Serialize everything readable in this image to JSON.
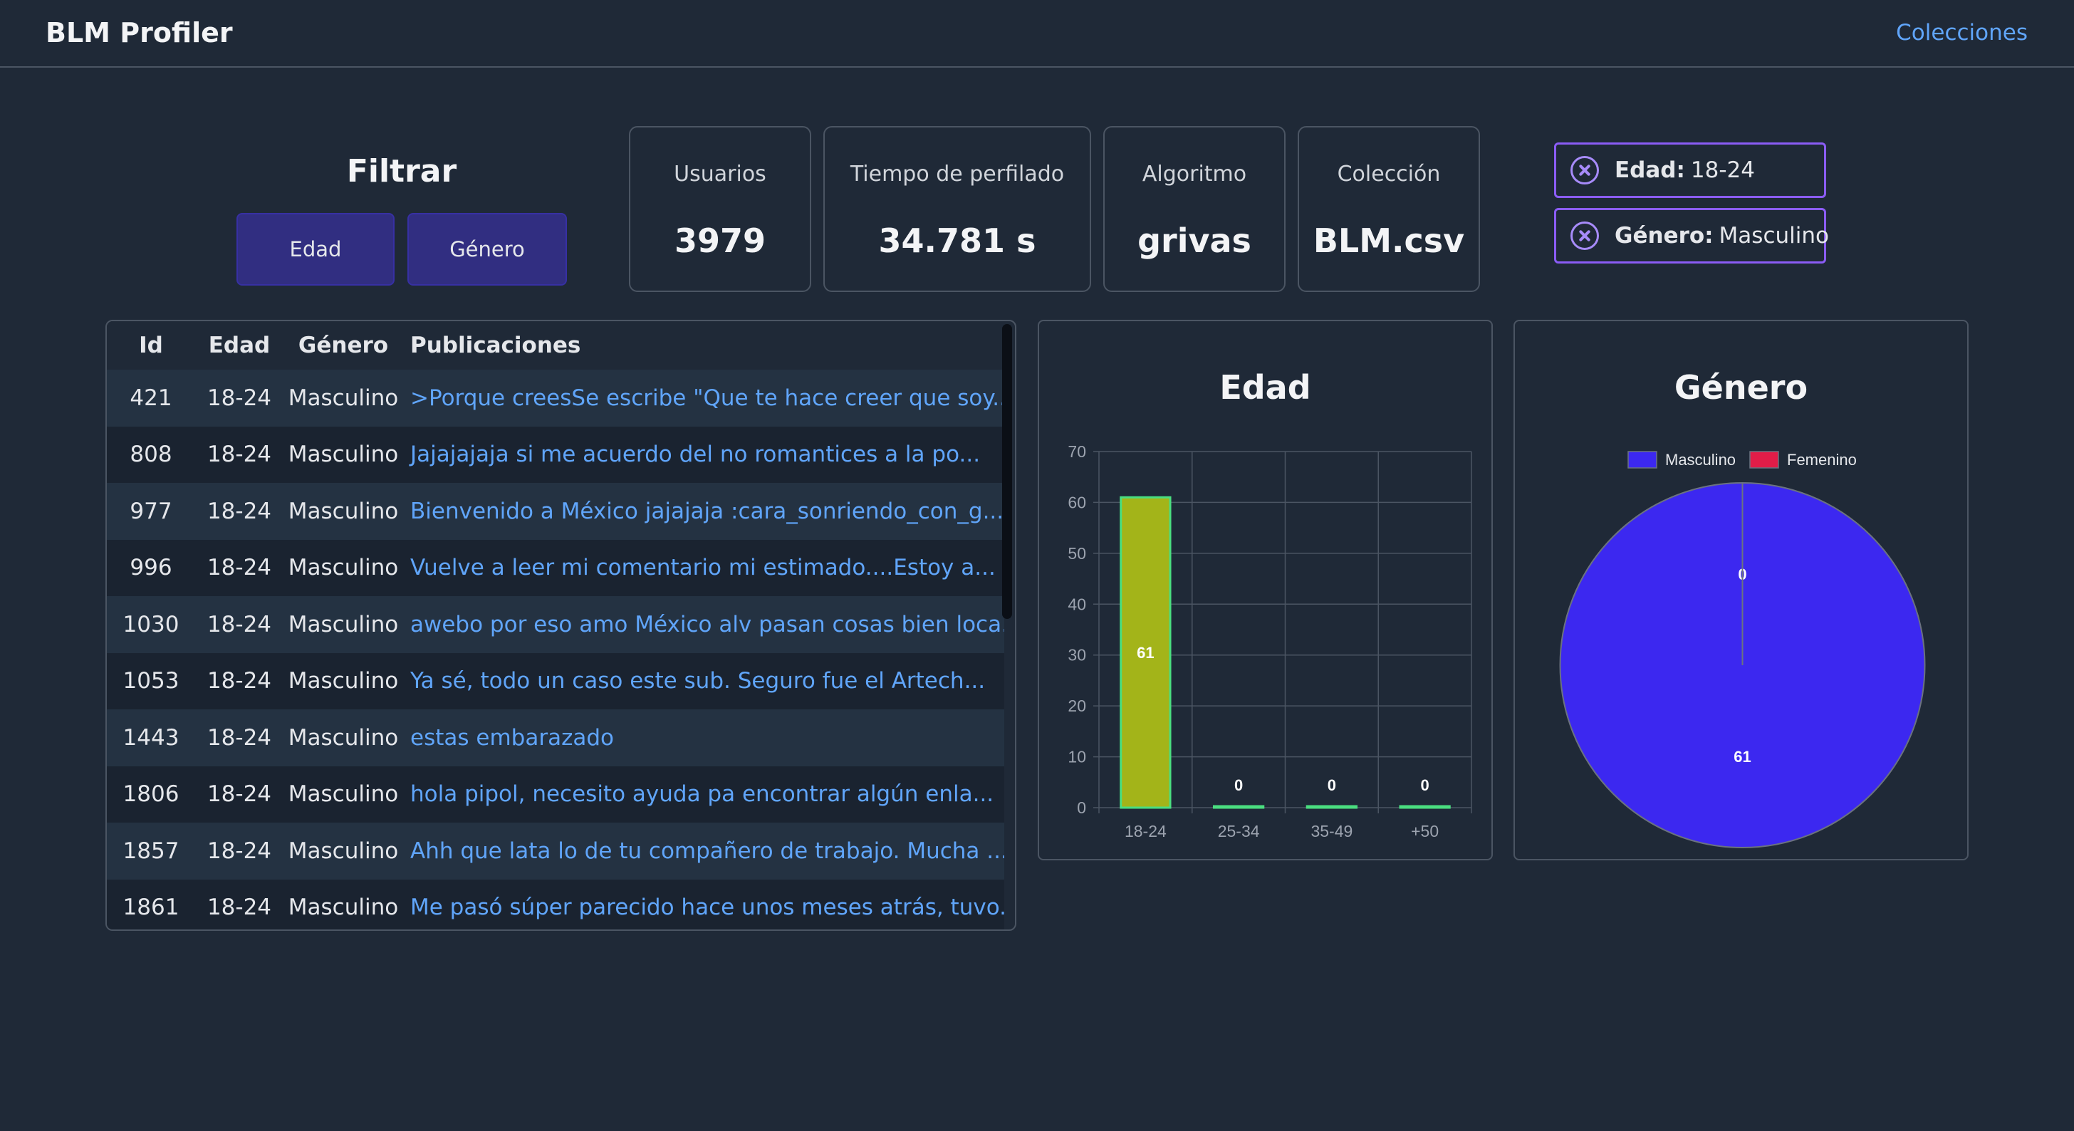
{
  "app": {
    "title": "BLM Profiler",
    "nav_link": "Colecciones"
  },
  "filter": {
    "title": "Filtrar",
    "buttons": [
      "Edad",
      "Género"
    ]
  },
  "stats": [
    {
      "label": "Usuarios",
      "value": "3979"
    },
    {
      "label": "Tiempo de perfilado",
      "value": "34.781 s"
    },
    {
      "label": "Algoritmo",
      "value": "grivas"
    },
    {
      "label": "Colección",
      "value": "BLM.csv"
    }
  ],
  "active_filters": [
    {
      "key": "Edad:",
      "value": "18-24",
      "icon": "close-circle-icon"
    },
    {
      "key": "Género:",
      "value": "Masculino",
      "icon": "close-circle-icon"
    }
  ],
  "table": {
    "headers": [
      "Id",
      "Edad",
      "Género",
      "Publicaciones"
    ],
    "rows": [
      [
        "421",
        "18-24",
        "Masculino",
        ">Porque creesSe escribe \"Que te hace creer que soy..."
      ],
      [
        "808",
        "18-24",
        "Masculino",
        "Jajajajaja si me acuerdo del no romantices a la po..."
      ],
      [
        "977",
        "18-24",
        "Masculino",
        "Bienvenido a México jajajaja :cara_sonriendo_con_g..."
      ],
      [
        "996",
        "18-24",
        "Masculino",
        "Vuelve a leer mi comentario mi estimado....Estoy a..."
      ],
      [
        "1030",
        "18-24",
        "Masculino",
        "awebo por eso amo México alv pasan cosas bien loca..."
      ],
      [
        "1053",
        "18-24",
        "Masculino",
        "Ya sé, todo un caso este sub. Seguro fue el Artech..."
      ],
      [
        "1443",
        "18-24",
        "Masculino",
        "estas embarazado"
      ],
      [
        "1806",
        "18-24",
        "Masculino",
        "hola pipol, necesito ayuda pa encontrar algún enla..."
      ],
      [
        "1857",
        "18-24",
        "Masculino",
        "Ahh que lata lo de tu compañero de trabajo. Mucha ..."
      ],
      [
        "1861",
        "18-24",
        "Masculino",
        "Me pasó súper parecido hace unos meses atrás, tuvo..."
      ]
    ]
  },
  "chart_data": [
    {
      "type": "bar",
      "title": "Edad",
      "categories": [
        "18-24",
        "25-34",
        "35-49",
        "+50"
      ],
      "values": [
        61,
        0,
        0,
        0
      ],
      "ylim": [
        0,
        70
      ],
      "yticks": [
        0,
        10,
        20,
        30,
        40,
        50,
        60,
        70
      ],
      "grid": true,
      "bar_color": "#a3b419",
      "bar_border": "#4ade80"
    },
    {
      "type": "pie",
      "title": "Género",
      "legend": [
        "Masculino",
        "Femenino"
      ],
      "legend_position": "top",
      "values": [
        61,
        0
      ],
      "colors": [
        "#3c28f0",
        "#e11d48"
      ]
    }
  ]
}
